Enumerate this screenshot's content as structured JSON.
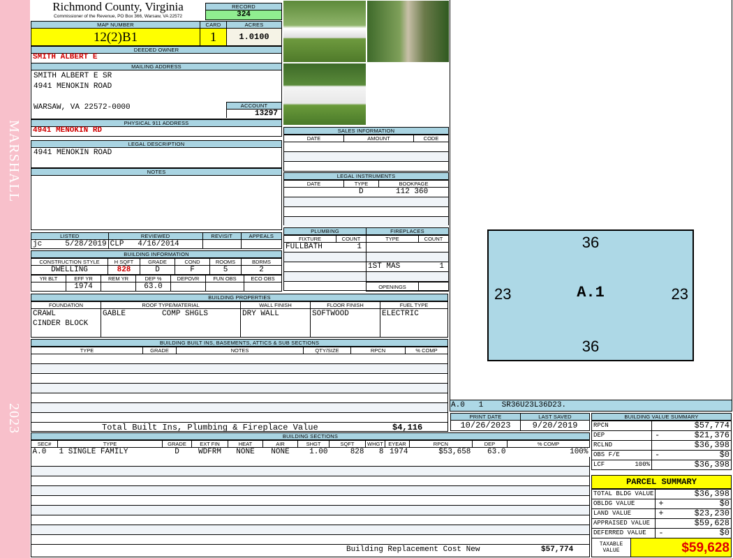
{
  "sidebar": {
    "district": "MARSHALL",
    "year": "2023"
  },
  "header": {
    "title": "Richmond County, Virginia",
    "subtitle": "Commissioner of the Revenue, PO Box 366, Warsaw, VA 22572",
    "record_label": "RECORD",
    "record": "324"
  },
  "parcel": {
    "map_label": "MAP NUMBER",
    "map": "12(2)B1",
    "card_label": "CARD",
    "card": "1",
    "acres_label": "ACRES",
    "acres": "1.0100"
  },
  "owner": {
    "label": "DEEDED OWNER",
    "value": "SMITH ALBERT E"
  },
  "mailing": {
    "label": "MAILING ADDRESS",
    "line1": "SMITH ALBERT E SR",
    "line2": "4941 MENOKIN ROAD",
    "line3": "WARSAW, VA 22572-0000",
    "account_label": "ACCOUNT",
    "account": "13297"
  },
  "physical": {
    "label": "PHYSICAL 911 ADDRESS",
    "value": "4941 MENOKIN RD"
  },
  "legal": {
    "label": "LEGAL DESCRIPTION",
    "value": "4941 MENOKIN ROAD"
  },
  "notes": {
    "label": "NOTES"
  },
  "listing": {
    "headers": [
      "LISTED",
      "REVIEWED",
      "REVISIT",
      "APPEALS"
    ],
    "listed": "jc     5/28/2019",
    "reviewed": "CLP   4/16/2014",
    "revisit": "",
    "appeals": ""
  },
  "building_info": {
    "title": "BUILDING INFORMATION",
    "headers1": [
      "CONSTRUCTION STYLE",
      "H SQFT",
      "GRADE",
      "COND",
      "ROOMS",
      "BDRMS"
    ],
    "values1": [
      "DWELLING",
      "828",
      "D",
      "F",
      "5",
      "2"
    ],
    "headers2": [
      "YR BLT",
      "EFF YR",
      "REM YR",
      "DEP %",
      "DEPOVR",
      "FUN OBS",
      "ECO OBS"
    ],
    "values2": [
      "",
      "1974",
      "",
      "63.0",
      "",
      "",
      ""
    ]
  },
  "properties": {
    "title": "BUILDING PROPERTIES",
    "headers": [
      "FOUNDATION",
      "ROOF TYPE/MATERIAL",
      "WALL FINISH",
      "FLOOR FINISH",
      "FUEL TYPE"
    ],
    "foundation1": "CRAWL",
    "foundation2": "CINDER BLOCK",
    "roof_type": "GABLE",
    "roof_material": "COMP SHGLS",
    "wall": "DRY WALL",
    "floor": "SOFTWOOD",
    "fuel": "ELECTRIC"
  },
  "builtins": {
    "title": "BUILDING BUILT INS, BASEMENTS, ATTICS & SUB SECTIONS",
    "headers": [
      "TYPE",
      "GRADE",
      "NOTES",
      "QTY/SIZE",
      "RPCN",
      "% COMP"
    ],
    "total_label": "Total Built Ins, Plumbing & Fireplace Value",
    "total": "$4,116"
  },
  "sections": {
    "title": "BUILDING SECTIONS",
    "headers": [
      "SEC#",
      "TYPE",
      "GRADE",
      "EXT FIN",
      "HEAT",
      "AIR",
      "SHGT",
      "SQFT",
      "WHGT",
      "EYEAR",
      "RPCN",
      "DEP",
      "% COMP"
    ],
    "rows": [
      [
        "A.0",
        "1 SINGLE FAMILY",
        "D",
        "WDFRM",
        "NONE",
        "NONE",
        "1.00",
        "828",
        "8",
        "1974",
        "$53,658",
        "63.0",
        "100%"
      ]
    ],
    "replacement_label": "Building Replacement Cost New",
    "replacement": "$57,774"
  },
  "sales": {
    "title": "SALES INFORMATION",
    "headers": [
      "DATE",
      "AMOUNT",
      "CODE"
    ]
  },
  "instruments": {
    "title": "LEGAL INSTRUMENTS",
    "headers": [
      "DATE",
      "TYPE",
      "BOOKPAGE"
    ],
    "type": "D",
    "bookpage": "112 360"
  },
  "plumbing": {
    "title": "PLUMBING",
    "headers": [
      "FIXTURE",
      "COUNT"
    ],
    "fixture": "FULLBATH",
    "count": "1"
  },
  "fireplaces": {
    "title": "FIREPLACES",
    "headers": [
      "TYPE",
      "COUNT"
    ],
    "type": "1ST MAS",
    "count": "1",
    "openings_label": "OPENINGS"
  },
  "sketch": {
    "top": "36",
    "bottom": "36",
    "left": "23",
    "right": "23",
    "label": "A.1",
    "code": "A.0   1    SR36U23L36D23."
  },
  "dates": {
    "print_label": "PRINT DATE",
    "print": "10/26/2023",
    "saved_label": "LAST SAVED",
    "saved": "9/20/2019"
  },
  "value_summary": {
    "title": "BUILDING VALUE SUMMARY",
    "rows": [
      {
        "label": "RPCN",
        "sign": "",
        "value": "$57,774"
      },
      {
        "label": "DEP",
        "sign": "-",
        "value": "$21,376"
      },
      {
        "label": "RCLND",
        "sign": "",
        "value": "$36,398"
      },
      {
        "label": "OBS F/E",
        "sign": "-",
        "value": "$0"
      },
      {
        "label": "LCF        100%",
        "sign": "",
        "value": "$36,398"
      }
    ]
  },
  "parcel_summary": {
    "title": "PARCEL SUMMARY",
    "rows": [
      {
        "label": "TOTAL BLDG VALUE",
        "sign": "",
        "value": "$36,398"
      },
      {
        "label": "OBLDG VALUE",
        "sign": "+",
        "value": "$0"
      },
      {
        "label": "LAND VALUE",
        "sign": "+",
        "value": "$23,230"
      },
      {
        "label": "APPRAISED VALUE",
        "sign": "",
        "value": "$59,628"
      },
      {
        "label": "DEFERRED VALUE",
        "sign": "-",
        "value": "$0"
      }
    ],
    "taxable_label": "TAXABLE VALUE",
    "taxable": "$59,628"
  }
}
